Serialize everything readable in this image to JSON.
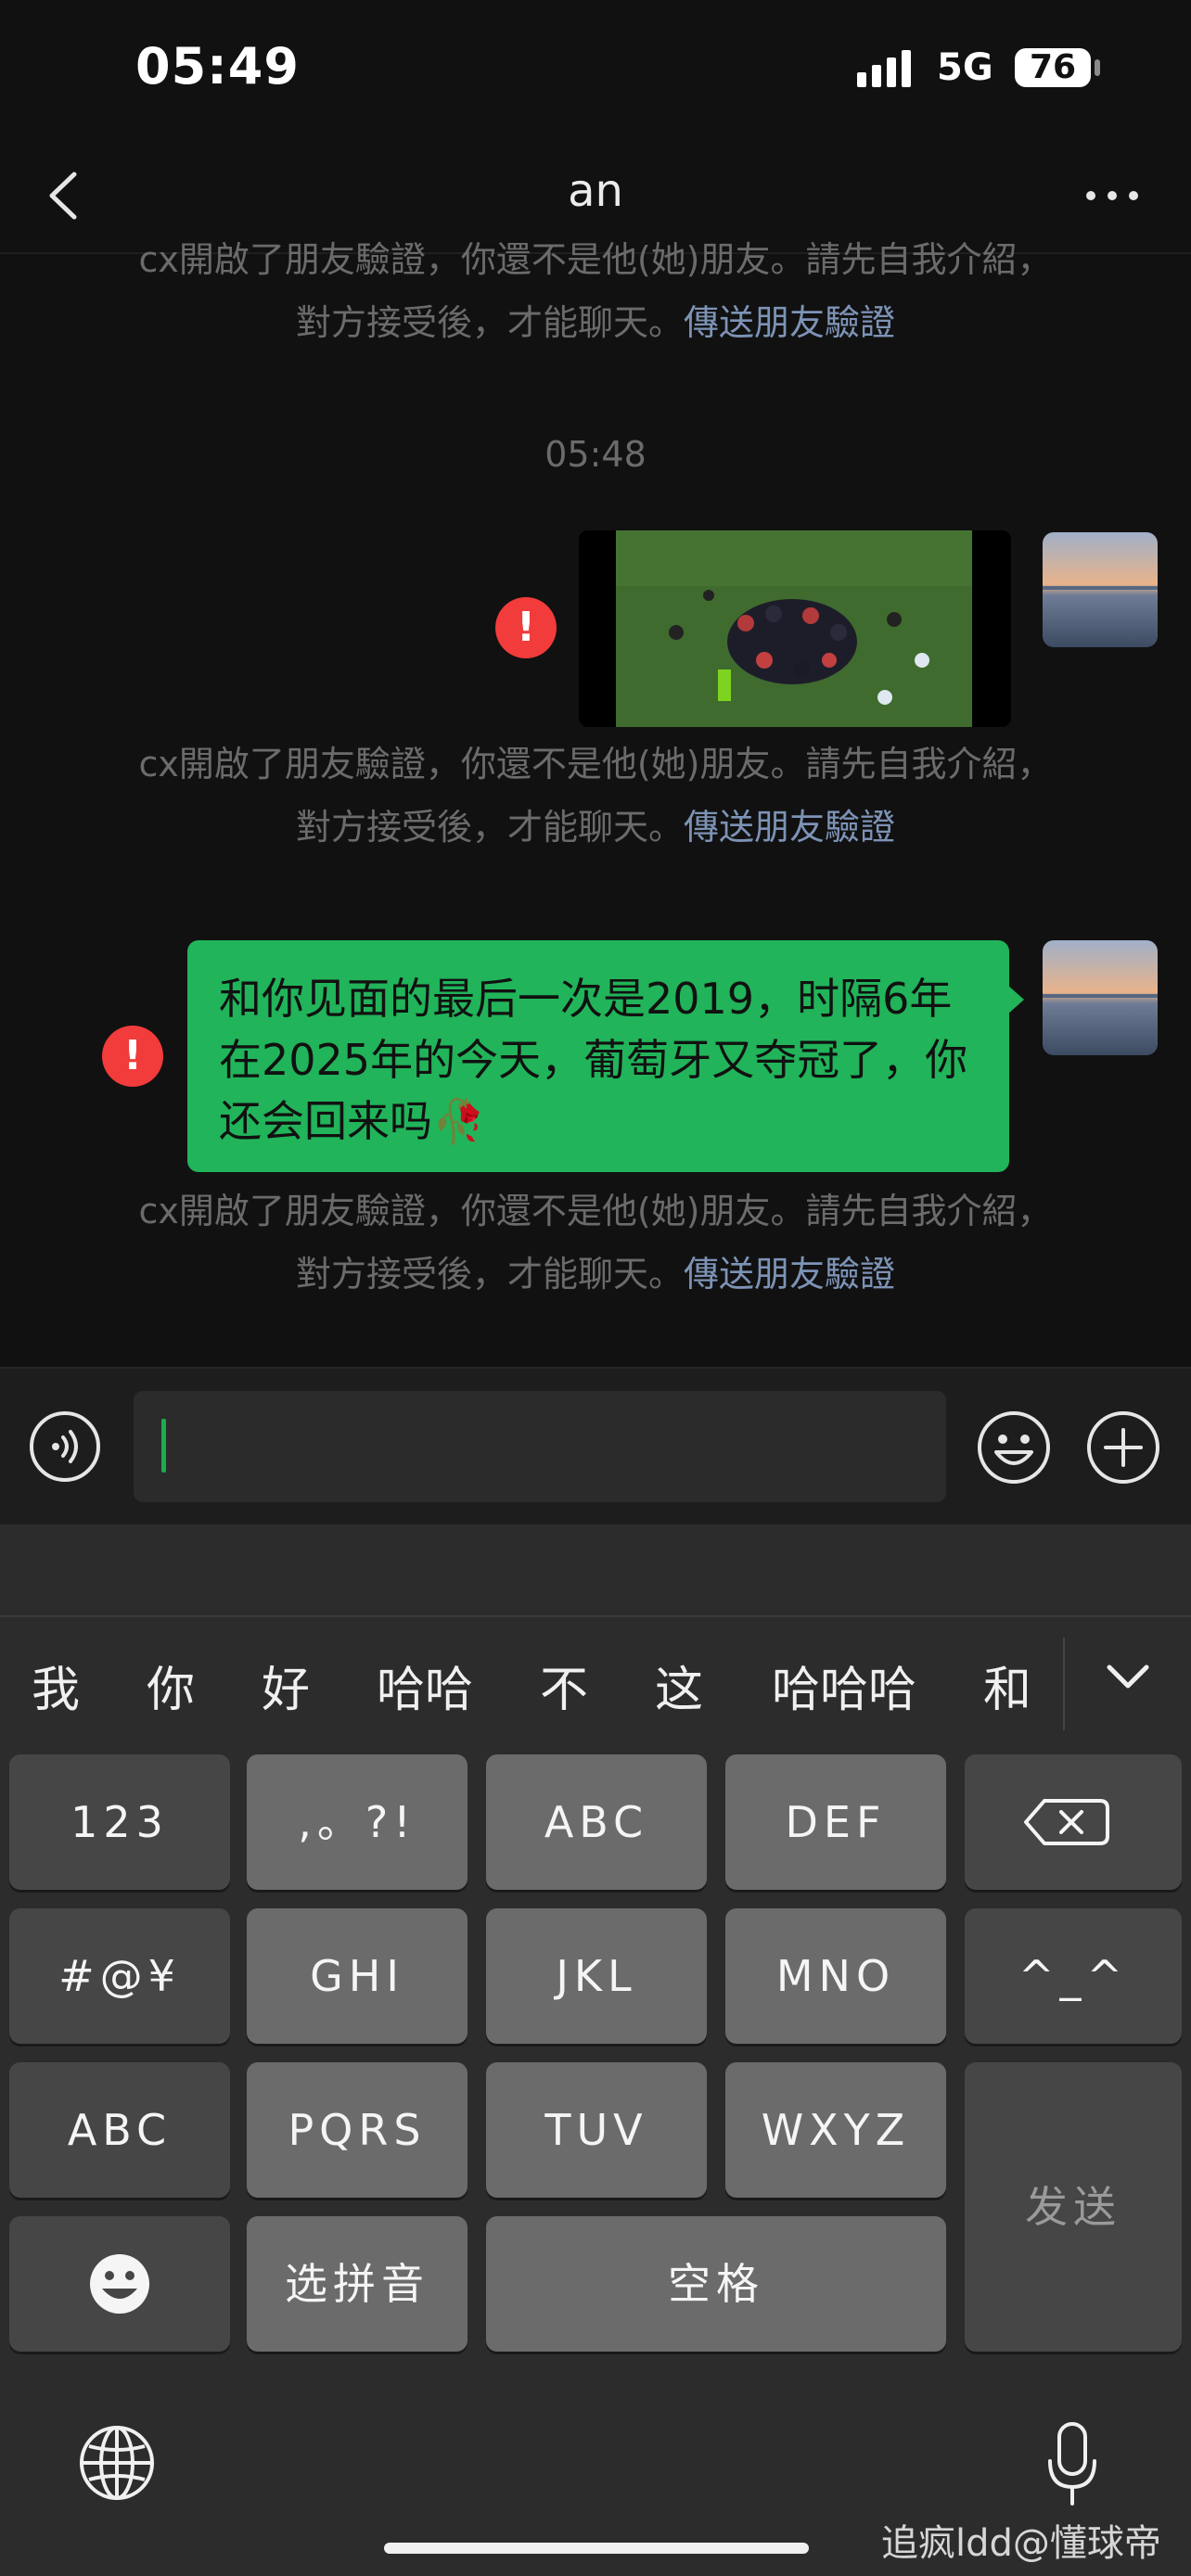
{
  "status_bar": {
    "time": "05:49",
    "network": "5G",
    "battery": "76"
  },
  "nav": {
    "title": "an",
    "back_icon": "chevron-left-icon",
    "more_icon": "more-icon"
  },
  "chat": {
    "sys_note_1": {
      "line1": "cx開啟了朋友驗證，你還不是他(她)朋友。請先自我介紹，",
      "line2_prefix": "對方接受後，才能聊天。",
      "link": "傳送朋友驗證"
    },
    "timestamp": "05:48",
    "sys_note_2": {
      "line1": "cx開啟了朋友驗證，你還不是他(她)朋友。請先自我介紹，",
      "line2_prefix": "對方接受後，才能聊天。",
      "link": "傳送朋友驗證"
    },
    "message": "和你见面的最后一次是2019，时隔6年在2025年的今天，葡萄牙又夺冠了，你还会回来吗🥀",
    "error_mark": "!",
    "sys_note_3": {
      "line1": "cx開啟了朋友驗證，你還不是他(她)朋友。請先自我介紹，",
      "line2_prefix": "對方接受後，才能聊天。",
      "link": "傳送朋友驗證"
    }
  },
  "keyboard": {
    "candidates": [
      "我",
      "你",
      "好",
      "哈哈",
      "不",
      "这",
      "哈哈哈",
      "和"
    ],
    "rows": {
      "r1": [
        "123",
        ",。?!",
        "ABC",
        "DEF",
        ""
      ],
      "r2": [
        "#@¥",
        "GHI",
        "JKL",
        "MNO",
        "^_^"
      ],
      "r3": [
        "ABC",
        "PQRS",
        "TUV",
        "WXYZ"
      ],
      "r4": [
        "",
        "选拼音",
        "空格"
      ]
    },
    "send": "发送"
  },
  "watermark": "追疯ldd@懂球帝",
  "colors": {
    "accent_green": "#21b45a",
    "error_red": "#f23b3b",
    "link_blue": "#7d93b6"
  }
}
